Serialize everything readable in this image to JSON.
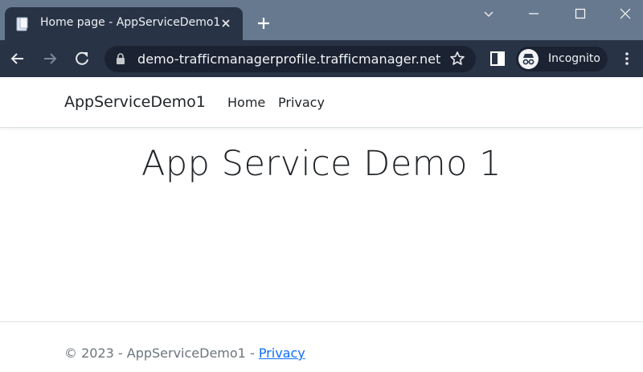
{
  "browser": {
    "tab": {
      "title": "Home page - AppServiceDemo1",
      "favicon": "page-icon"
    },
    "address_bar": {
      "url": "demo-trafficmanagerprofile.trafficmanager.net",
      "secure_icon": "lock-icon"
    },
    "profile": {
      "label": "Incognito",
      "icon": "incognito-icon"
    },
    "colors": {
      "titlebar": "#67798f",
      "toolbar": "#283346",
      "omnibox": "#1b2333"
    }
  },
  "site": {
    "brand": "AppServiceDemo1",
    "nav": [
      {
        "label": "Home"
      },
      {
        "label": "Privacy"
      }
    ],
    "heading": "App Service Demo 1",
    "footer": {
      "text": "© 2023 - AppServiceDemo1 - ",
      "link": "Privacy"
    },
    "colors": {
      "link": "#0d6efd",
      "footer_text": "#6c757d",
      "text": "#212529"
    }
  }
}
